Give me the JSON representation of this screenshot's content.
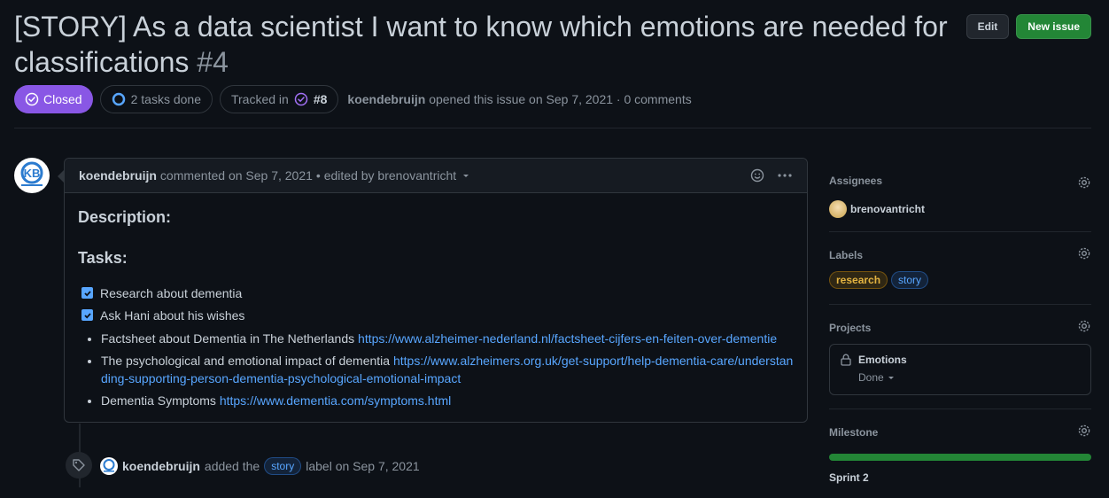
{
  "issue": {
    "title": "[STORY] As a data scientist I want to know which emotions are needed for classifications",
    "number": "#4",
    "state": "Closed",
    "tasks_done": "2 tasks done",
    "tracked_in_label": "Tracked in",
    "tracked_in_ref": "#8",
    "author": "koendebruijn",
    "opened_text": "opened this issue on Sep 7, 2021 · 0 comments"
  },
  "header_actions": {
    "edit_label": "Edit",
    "new_issue_label": "New issue"
  },
  "comment": {
    "author": "koendebruijn",
    "meta": "commented on Sep 7, 2021",
    "edited": "• edited by brenovantricht",
    "description_heading": "Description:",
    "tasks_heading": "Tasks:",
    "tasks": [
      {
        "label": "Research about dementia",
        "checked": true
      },
      {
        "label": "Ask Hani about his wishes",
        "checked": true
      }
    ],
    "links": [
      {
        "text": "Factsheet about Dementia in The Netherlands",
        "url": "https://www.alzheimer-nederland.nl/factsheet-cijfers-en-feiten-over-dementie"
      },
      {
        "text": "The psychological and emotional impact of dementia",
        "url": "https://www.alzheimers.org.uk/get-support/help-dementia-care/understanding-supporting-person-dementia-psychological-emotional-impact"
      },
      {
        "text": "Dementia Symptoms",
        "url": "https://www.dementia.com/symptoms.html"
      }
    ]
  },
  "timeline_event": {
    "author": "koendebruijn",
    "action": "added the",
    "label": "story",
    "suffix": "label on Sep 7, 2021"
  },
  "sidebar": {
    "assignees_title": "Assignees",
    "assignee": "brenovantricht",
    "labels_title": "Labels",
    "labels": [
      "research",
      "story"
    ],
    "projects_title": "Projects",
    "project_name": "Emotions",
    "project_status": "Done",
    "milestone_title": "Milestone",
    "milestone_name": "Sprint 2",
    "milestone_progress": 1.0
  },
  "colors": {
    "closed_badge": "#8957e5",
    "primary_button": "#238636",
    "link": "#58a6ff"
  },
  "avatar_initials": "KB"
}
